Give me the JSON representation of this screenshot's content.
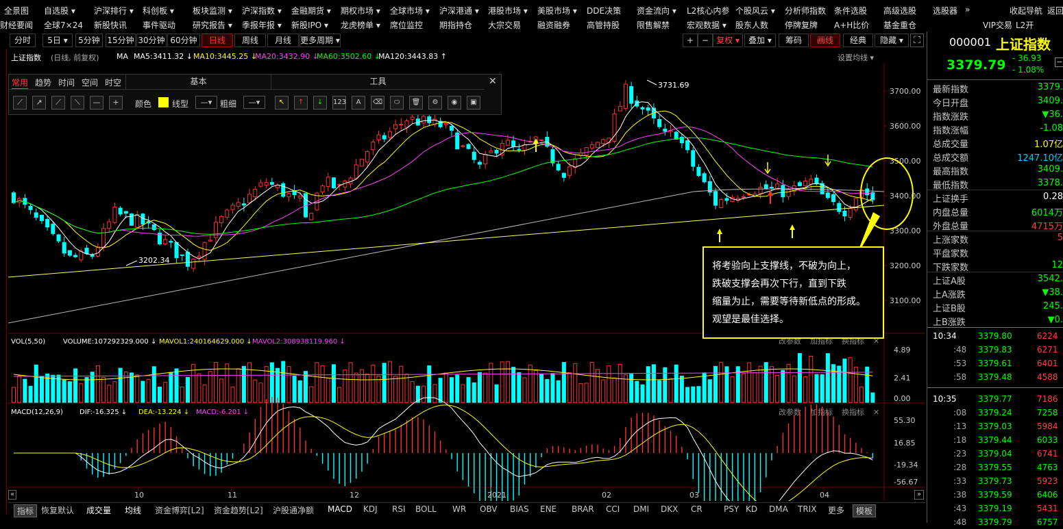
{
  "menu_row1": [
    "全景图",
    "自选股 ▾",
    "沪深排行 ▾",
    "科创板 ▾",
    "板块监测 ▾",
    "沪深指数 ▾",
    "金融期货 ▾",
    "期权市场 ▾",
    "全球市场 ▾",
    "沪深港通 ▾",
    "港股市场 ▾",
    "美股市场 ▾",
    "DDE决策",
    "资金流向 ▾",
    "L2核心内参",
    "个股风云 ▾",
    "分析师指数",
    "条件选股",
    "高级选股",
    "选股器",
    "»",
    "收起导航",
    "返回"
  ],
  "menu_row2": [
    "财经要闻",
    "全球7×24",
    "新股快讯",
    "事件驱动",
    "研究报告 ▾",
    "季报年报 ▾",
    "新股IPO ▾",
    "龙虎榜单 ▾",
    "席位监控",
    "期指持仓",
    "大宗交易",
    "融资融券",
    "高管持股",
    "限售解禁",
    "宏观数据 ▾",
    "股东人数",
    "停牌复牌",
    "A+H比价",
    "基金重仓",
    "VIP交易",
    "L2开"
  ],
  "periods": [
    "分时",
    "5日 ▾",
    "5分钟",
    "15分钟",
    "30分钟",
    "60分钟",
    "日线",
    "周线",
    "月线",
    "更多周期 ▾"
  ],
  "active_period": "日线",
  "right_tools": [
    "+",
    "−",
    "复权 ▾",
    "叠加 ▾",
    "筹码",
    "画线",
    "经典",
    "隐藏 ▾"
  ],
  "index": {
    "code": "000001",
    "name": "上证指数",
    "price": "3379.79",
    "change": "- 36.93",
    "pct": "- 1.08%"
  },
  "ma_line": {
    "title": "上证指数",
    "mode": "(日线, 前复权)",
    "ma5": "MA5:3411.32 ↓",
    "ma10": "MA10:3445.25 ↓",
    "ma20": "MA20:3432.90 ↓",
    "ma60": "MA60:3502.60 ↓",
    "ma120": "MA120:3443.83 ↑",
    "setting": "设置均线 ▾"
  },
  "draw_panel": {
    "tabs": [
      "常用",
      "趋势",
      "时间",
      "空间",
      "时空"
    ],
    "basic": "基本",
    "tools": "工具",
    "color": "颜色",
    "line_type": "线型",
    "thickness": "粗细",
    "line_sym": "—▾",
    "close": "✕"
  },
  "price_axis": [
    "3700.00",
    "3600.00",
    "3500.00",
    "3400.00",
    "3300.00",
    "3200.00",
    "3100.00"
  ],
  "price_labels": {
    "high": "3731.69",
    "low": "3202.34"
  },
  "vol_line": {
    "title": "VOL(5,50)",
    "volume": "VOLUME:107292329.000 ↓",
    "mavol1": "MAVOL1:240164629.000 ↓",
    "mavol2": "MAVOL2:308938119.960 ↓"
  },
  "vol_axis": [
    "4.89",
    "2.41",
    "0.00"
  ],
  "macd_line": {
    "title": "MACD(12,26,9)",
    "dif": "DIF:-16.325 ↓",
    "dea": "DEA:-13.224 ↓",
    "macd": "MACD:-6.201 ↓"
  },
  "macd_axis": [
    "55.30",
    "16.85",
    "-19.34",
    "-56.67"
  ],
  "pane_buttons": [
    "改参数",
    "加指标",
    "换指标",
    "✕"
  ],
  "x_axis": [
    "10",
    "11",
    "12",
    "2021",
    "02",
    "03",
    "04"
  ],
  "annotation": [
    "将考验向上支撑线，不破为向上，",
    "跌破支撑会再次下行，直到下跌",
    "缩量为止，需要等待新低点的形成。",
    "观望是最佳选择。"
  ],
  "quote": [
    {
      "label": "最新指数",
      "value": "3379.",
      "color": "#00ff00"
    },
    {
      "label": "今日开盘",
      "value": "3409.",
      "color": "#00ff00"
    },
    {
      "label": "指数涨跌",
      "value": "▼36.",
      "color": "#00ff00"
    },
    {
      "label": "指数涨幅",
      "value": "-1.08",
      "color": "#00ff00"
    },
    {
      "label": "总成交量",
      "value": "1.07亿",
      "color": "#ffff00"
    },
    {
      "label": "总成交额",
      "value": "1247.10亿",
      "color": "#00ccff"
    },
    {
      "label": "最高指数",
      "value": "3409.",
      "color": "#00ff00"
    },
    {
      "label": "最低指数",
      "value": "3378.",
      "color": "#00ff00"
    },
    {
      "label": "上证换手",
      "value": "0.28",
      "color": "#ffffff"
    },
    {
      "label": "内盘总量",
      "value": "6014万",
      "color": "#00ff00"
    },
    {
      "label": "外盘总量",
      "value": "4715万",
      "color": "#ff4040"
    },
    {
      "label": "上涨家数",
      "value": "5",
      "color": "#ff4040"
    },
    {
      "label": "平盘家数",
      "value": "",
      "color": "#ffffff"
    },
    {
      "label": "下跌家数",
      "value": "12",
      "color": "#00ff00"
    },
    {
      "label": "上证A股",
      "value": "3542.",
      "color": "#00ff00"
    },
    {
      "label": "上A涨跌",
      "value": "▼38.",
      "color": "#00ff00"
    },
    {
      "label": "上证B股",
      "value": "245.",
      "color": "#00ff00"
    },
    {
      "label": "上B涨跌",
      "value": "▼0.",
      "color": "#00ff00"
    }
  ],
  "ticks_1": [
    {
      "t": "10:34",
      "p": "3379.80",
      "v": "6224"
    },
    {
      "t": ":48",
      "p": "3379.83",
      "v": "6271"
    },
    {
      "t": ":53",
      "p": "3379.61",
      "v": "6401"
    },
    {
      "t": ":58",
      "p": "3379.48",
      "v": "4588"
    }
  ],
  "ticks_2": [
    {
      "t": "10:35",
      "p": "3379.77",
      "v": "7186"
    },
    {
      "t": ":08",
      "p": "3379.24",
      "v": "7258"
    },
    {
      "t": ":13",
      "p": "3379.03",
      "v": "5984"
    },
    {
      "t": ":18",
      "p": "3379.44",
      "v": "6033"
    },
    {
      "t": ":23",
      "p": "3379.04",
      "v": "6741"
    },
    {
      "t": ":28",
      "p": "3379.55",
      "v": "4763"
    },
    {
      "t": ":33",
      "p": "3379.73",
      "v": "5923"
    },
    {
      "t": ":38",
      "p": "3379.59",
      "v": "6406"
    },
    {
      "t": ":43",
      "p": "3379.19",
      "v": "5431"
    },
    {
      "t": ":48",
      "p": "3379.79",
      "v": "6757"
    }
  ],
  "bottom_tabs": [
    "指标",
    "恢复默认",
    "成交量",
    "均线",
    "资金博弈[L2]",
    "资金趋势[L2]",
    "沪股通净额",
    "MACD",
    "KDJ",
    "RSI",
    "BOLL",
    "WR",
    "OBV",
    "BIAS",
    "ENE",
    "BRAR",
    "CCI",
    "DMI",
    "DKX",
    "CR",
    "PSY",
    "KD",
    "DMA",
    "TRIX",
    "更多",
    "模板"
  ]
}
